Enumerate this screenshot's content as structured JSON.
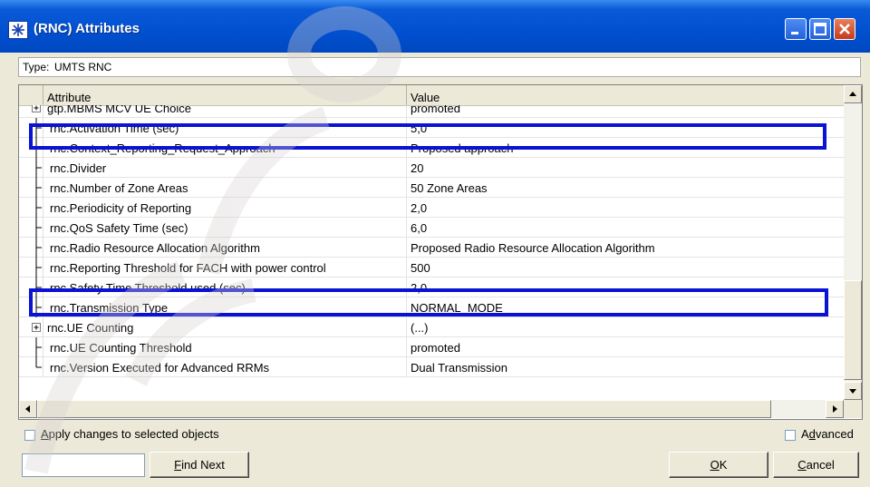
{
  "window": {
    "title": "(RNC) Attributes",
    "accent": "#0050d0",
    "controls": [
      "minimize-icon",
      "maximize-icon",
      "close-icon"
    ]
  },
  "type": {
    "label": "Type:",
    "value": "UMTS RNC"
  },
  "table": {
    "headers": {
      "attribute": "Attribute",
      "value": "Value"
    },
    "rows": [
      {
        "name": "gtp.MBMS MCV UE Choice",
        "value": "promoted",
        "tree": "plus",
        "partial": true
      },
      {
        "name": "rnc.Activation Time (sec)",
        "value": "5,0",
        "tree": "branch"
      },
      {
        "name": "rnc.Context_Reporting_Request_Approach",
        "value": "Proposed approach",
        "tree": "branch"
      },
      {
        "name": "rnc.Divider",
        "value": "20",
        "tree": "branch"
      },
      {
        "name": "rnc.Number of Zone Areas",
        "value": "50 Zone Areas",
        "tree": "branch"
      },
      {
        "name": "rnc.Periodicity of Reporting",
        "value": "2,0",
        "tree": "branch"
      },
      {
        "name": "rnc.QoS Safety Time (sec)",
        "value": "6,0",
        "tree": "branch"
      },
      {
        "name": "rnc.Radio Resource Allocation Algorithm",
        "value": "Proposed Radio Resource Allocation Algorithm",
        "tree": "branch"
      },
      {
        "name": "rnc.Reporting Threshold for FACH with power control",
        "value": "500",
        "tree": "branch"
      },
      {
        "name": "rnc.Safety Time Threshold used (sec)",
        "value": "2,0",
        "tree": "branch"
      },
      {
        "name": "rnc.Transmission Type",
        "value": "NORMAL_MODE",
        "tree": "branch"
      },
      {
        "name": "rnc.UE Counting",
        "value": "(...)",
        "tree": "plus"
      },
      {
        "name": "rnc.UE Counting Threshold",
        "value": "promoted",
        "tree": "branch"
      },
      {
        "name": "rnc.Version Executed for Advanced RRMs",
        "value": "Dual Transmission",
        "tree": "last"
      }
    ],
    "highlight_color": "#0a12d4"
  },
  "bottom": {
    "apply_label": "Apply changes to selected objects",
    "advanced_label": "Advanced",
    "find_next_label": "Find Next",
    "ok_label": "OK",
    "cancel_label": "Cancel"
  }
}
